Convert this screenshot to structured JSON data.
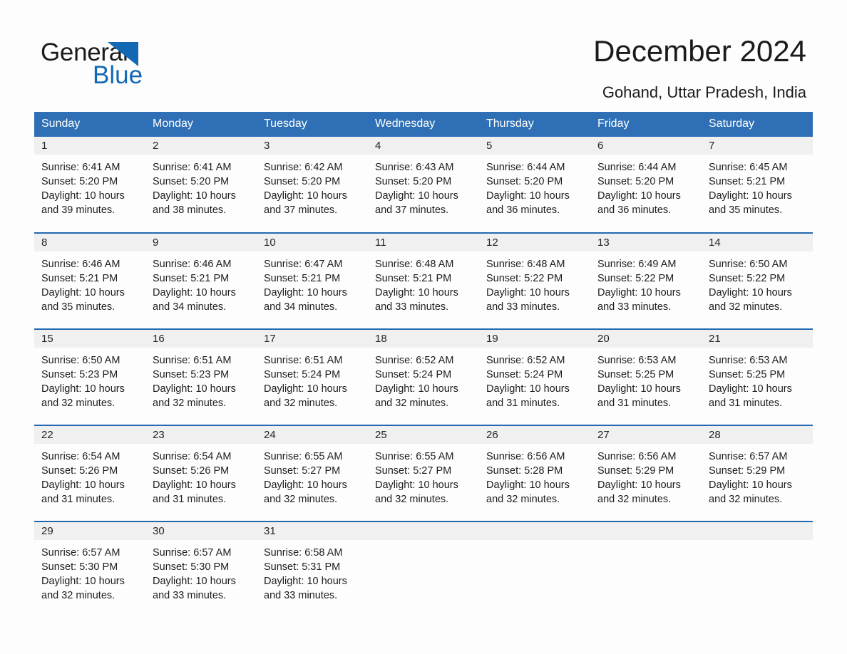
{
  "brand": {
    "name_part1": "General",
    "name_part2": "Blue",
    "triangle_color": "#1268b3",
    "icon": "triangle-logo-icon"
  },
  "header": {
    "title": "December 2024",
    "subtitle": "Gohand, Uttar Pradesh, India",
    "header_bg_color": "#2f6fb5",
    "divider_color": "#2568b0",
    "daynum_bg_color": "#f0f0f0"
  },
  "weekdays": [
    "Sunday",
    "Monday",
    "Tuesday",
    "Wednesday",
    "Thursday",
    "Friday",
    "Saturday"
  ],
  "weeks": [
    [
      {
        "day": "1",
        "sunrise": "Sunrise: 6:41 AM",
        "sunset": "Sunset: 5:20 PM",
        "daylight1": "Daylight: 10 hours",
        "daylight2": "and 39 minutes."
      },
      {
        "day": "2",
        "sunrise": "Sunrise: 6:41 AM",
        "sunset": "Sunset: 5:20 PM",
        "daylight1": "Daylight: 10 hours",
        "daylight2": "and 38 minutes."
      },
      {
        "day": "3",
        "sunrise": "Sunrise: 6:42 AM",
        "sunset": "Sunset: 5:20 PM",
        "daylight1": "Daylight: 10 hours",
        "daylight2": "and 37 minutes."
      },
      {
        "day": "4",
        "sunrise": "Sunrise: 6:43 AM",
        "sunset": "Sunset: 5:20 PM",
        "daylight1": "Daylight: 10 hours",
        "daylight2": "and 37 minutes."
      },
      {
        "day": "5",
        "sunrise": "Sunrise: 6:44 AM",
        "sunset": "Sunset: 5:20 PM",
        "daylight1": "Daylight: 10 hours",
        "daylight2": "and 36 minutes."
      },
      {
        "day": "6",
        "sunrise": "Sunrise: 6:44 AM",
        "sunset": "Sunset: 5:20 PM",
        "daylight1": "Daylight: 10 hours",
        "daylight2": "and 36 minutes."
      },
      {
        "day": "7",
        "sunrise": "Sunrise: 6:45 AM",
        "sunset": "Sunset: 5:21 PM",
        "daylight1": "Daylight: 10 hours",
        "daylight2": "and 35 minutes."
      }
    ],
    [
      {
        "day": "8",
        "sunrise": "Sunrise: 6:46 AM",
        "sunset": "Sunset: 5:21 PM",
        "daylight1": "Daylight: 10 hours",
        "daylight2": "and 35 minutes."
      },
      {
        "day": "9",
        "sunrise": "Sunrise: 6:46 AM",
        "sunset": "Sunset: 5:21 PM",
        "daylight1": "Daylight: 10 hours",
        "daylight2": "and 34 minutes."
      },
      {
        "day": "10",
        "sunrise": "Sunrise: 6:47 AM",
        "sunset": "Sunset: 5:21 PM",
        "daylight1": "Daylight: 10 hours",
        "daylight2": "and 34 minutes."
      },
      {
        "day": "11",
        "sunrise": "Sunrise: 6:48 AM",
        "sunset": "Sunset: 5:21 PM",
        "daylight1": "Daylight: 10 hours",
        "daylight2": "and 33 minutes."
      },
      {
        "day": "12",
        "sunrise": "Sunrise: 6:48 AM",
        "sunset": "Sunset: 5:22 PM",
        "daylight1": "Daylight: 10 hours",
        "daylight2": "and 33 minutes."
      },
      {
        "day": "13",
        "sunrise": "Sunrise: 6:49 AM",
        "sunset": "Sunset: 5:22 PM",
        "daylight1": "Daylight: 10 hours",
        "daylight2": "and 33 minutes."
      },
      {
        "day": "14",
        "sunrise": "Sunrise: 6:50 AM",
        "sunset": "Sunset: 5:22 PM",
        "daylight1": "Daylight: 10 hours",
        "daylight2": "and 32 minutes."
      }
    ],
    [
      {
        "day": "15",
        "sunrise": "Sunrise: 6:50 AM",
        "sunset": "Sunset: 5:23 PM",
        "daylight1": "Daylight: 10 hours",
        "daylight2": "and 32 minutes."
      },
      {
        "day": "16",
        "sunrise": "Sunrise: 6:51 AM",
        "sunset": "Sunset: 5:23 PM",
        "daylight1": "Daylight: 10 hours",
        "daylight2": "and 32 minutes."
      },
      {
        "day": "17",
        "sunrise": "Sunrise: 6:51 AM",
        "sunset": "Sunset: 5:24 PM",
        "daylight1": "Daylight: 10 hours",
        "daylight2": "and 32 minutes."
      },
      {
        "day": "18",
        "sunrise": "Sunrise: 6:52 AM",
        "sunset": "Sunset: 5:24 PM",
        "daylight1": "Daylight: 10 hours",
        "daylight2": "and 32 minutes."
      },
      {
        "day": "19",
        "sunrise": "Sunrise: 6:52 AM",
        "sunset": "Sunset: 5:24 PM",
        "daylight1": "Daylight: 10 hours",
        "daylight2": "and 31 minutes."
      },
      {
        "day": "20",
        "sunrise": "Sunrise: 6:53 AM",
        "sunset": "Sunset: 5:25 PM",
        "daylight1": "Daylight: 10 hours",
        "daylight2": "and 31 minutes."
      },
      {
        "day": "21",
        "sunrise": "Sunrise: 6:53 AM",
        "sunset": "Sunset: 5:25 PM",
        "daylight1": "Daylight: 10 hours",
        "daylight2": "and 31 minutes."
      }
    ],
    [
      {
        "day": "22",
        "sunrise": "Sunrise: 6:54 AM",
        "sunset": "Sunset: 5:26 PM",
        "daylight1": "Daylight: 10 hours",
        "daylight2": "and 31 minutes."
      },
      {
        "day": "23",
        "sunrise": "Sunrise: 6:54 AM",
        "sunset": "Sunset: 5:26 PM",
        "daylight1": "Daylight: 10 hours",
        "daylight2": "and 31 minutes."
      },
      {
        "day": "24",
        "sunrise": "Sunrise: 6:55 AM",
        "sunset": "Sunset: 5:27 PM",
        "daylight1": "Daylight: 10 hours",
        "daylight2": "and 32 minutes."
      },
      {
        "day": "25",
        "sunrise": "Sunrise: 6:55 AM",
        "sunset": "Sunset: 5:27 PM",
        "daylight1": "Daylight: 10 hours",
        "daylight2": "and 32 minutes."
      },
      {
        "day": "26",
        "sunrise": "Sunrise: 6:56 AM",
        "sunset": "Sunset: 5:28 PM",
        "daylight1": "Daylight: 10 hours",
        "daylight2": "and 32 minutes."
      },
      {
        "day": "27",
        "sunrise": "Sunrise: 6:56 AM",
        "sunset": "Sunset: 5:29 PM",
        "daylight1": "Daylight: 10 hours",
        "daylight2": "and 32 minutes."
      },
      {
        "day": "28",
        "sunrise": "Sunrise: 6:57 AM",
        "sunset": "Sunset: 5:29 PM",
        "daylight1": "Daylight: 10 hours",
        "daylight2": "and 32 minutes."
      }
    ],
    [
      {
        "day": "29",
        "sunrise": "Sunrise: 6:57 AM",
        "sunset": "Sunset: 5:30 PM",
        "daylight1": "Daylight: 10 hours",
        "daylight2": "and 32 minutes."
      },
      {
        "day": "30",
        "sunrise": "Sunrise: 6:57 AM",
        "sunset": "Sunset: 5:30 PM",
        "daylight1": "Daylight: 10 hours",
        "daylight2": "and 33 minutes."
      },
      {
        "day": "31",
        "sunrise": "Sunrise: 6:58 AM",
        "sunset": "Sunset: 5:31 PM",
        "daylight1": "Daylight: 10 hours",
        "daylight2": "and 33 minutes."
      },
      {
        "day": "",
        "sunrise": "",
        "sunset": "",
        "daylight1": "",
        "daylight2": ""
      },
      {
        "day": "",
        "sunrise": "",
        "sunset": "",
        "daylight1": "",
        "daylight2": ""
      },
      {
        "day": "",
        "sunrise": "",
        "sunset": "",
        "daylight1": "",
        "daylight2": ""
      },
      {
        "day": "",
        "sunrise": "",
        "sunset": "",
        "daylight1": "",
        "daylight2": ""
      }
    ]
  ]
}
